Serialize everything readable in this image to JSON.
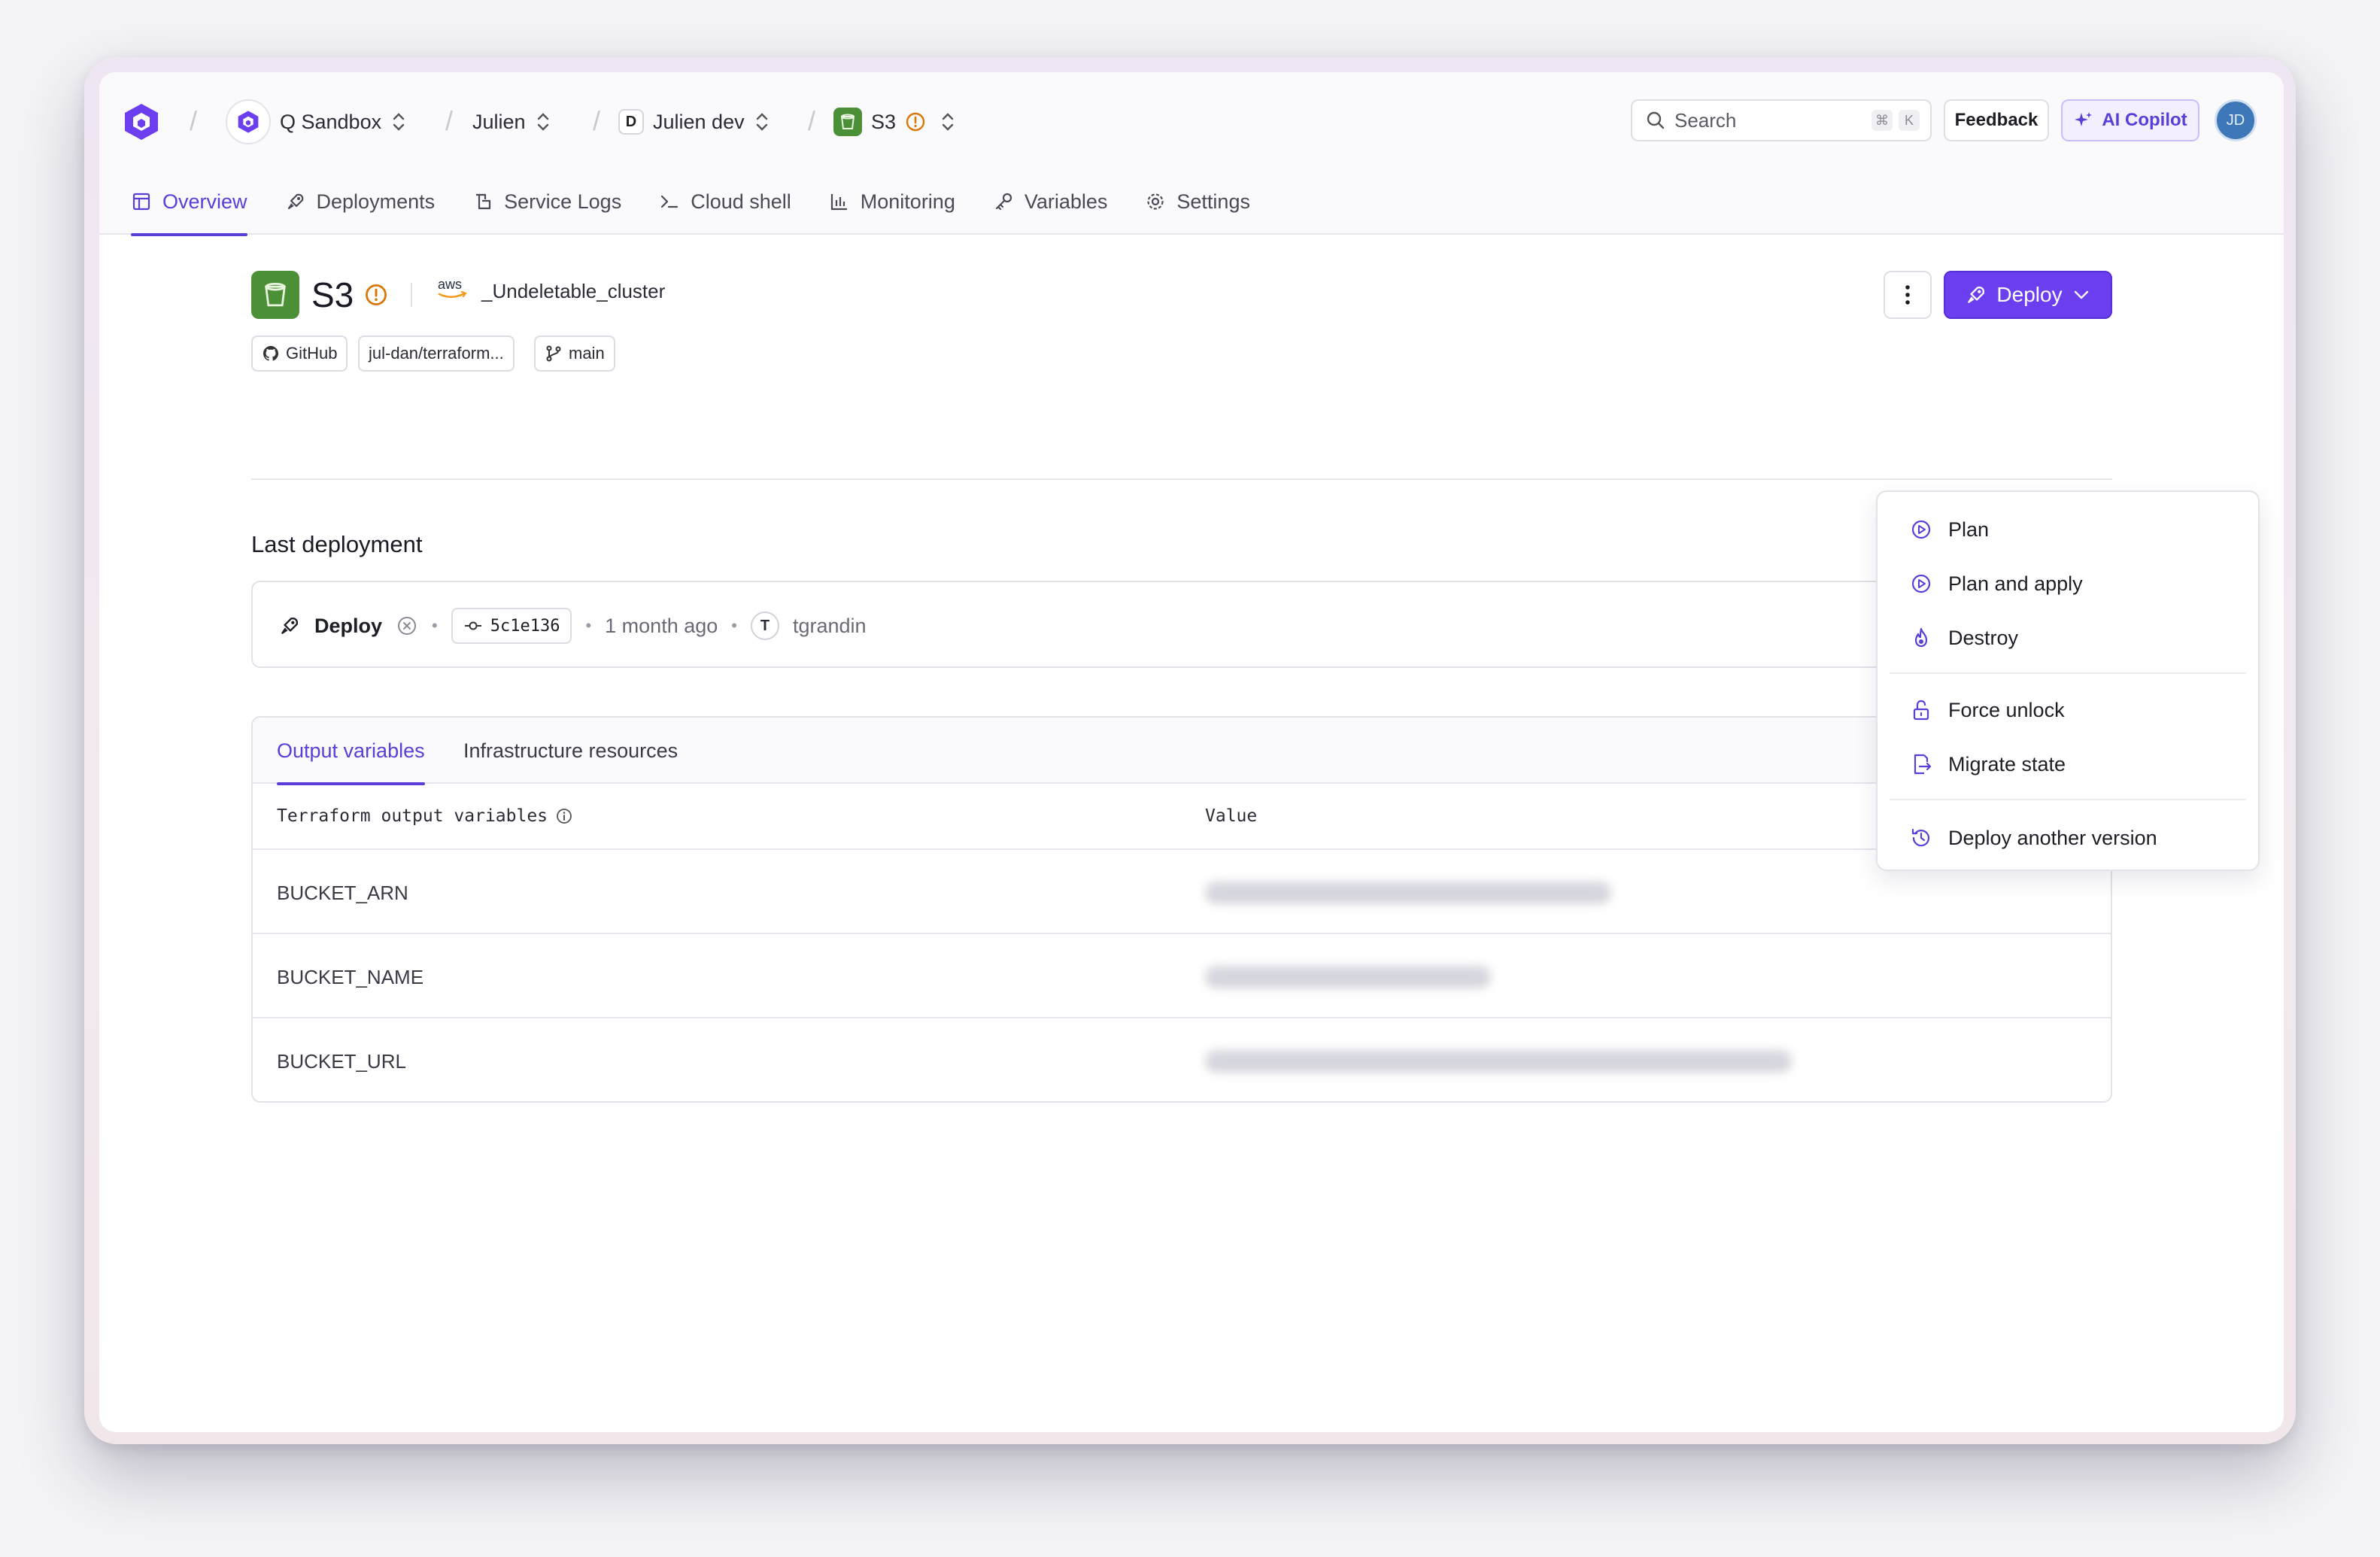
{
  "header": {
    "breadcrumbs": [
      {
        "label": "Q Sandbox"
      },
      {
        "label": "Julien"
      },
      {
        "label": "Julien dev",
        "badge": "D"
      },
      {
        "label": "S3"
      }
    ],
    "search": {
      "placeholder": "Search",
      "shortcut": [
        "⌘",
        "K"
      ]
    },
    "feedback_label": "Feedback",
    "copilot_label": "AI Copilot",
    "user_initials": "JD"
  },
  "tabs": [
    {
      "label": "Overview",
      "active": true,
      "icon": "layout-icon"
    },
    {
      "label": "Deployments",
      "active": false,
      "icon": "rocket-icon"
    },
    {
      "label": "Service Logs",
      "active": false,
      "icon": "logs-icon"
    },
    {
      "label": "Cloud shell",
      "active": false,
      "icon": "terminal-icon"
    },
    {
      "label": "Monitoring",
      "active": false,
      "icon": "chart-icon"
    },
    {
      "label": "Variables",
      "active": false,
      "icon": "key-icon"
    },
    {
      "label": "Settings",
      "active": false,
      "icon": "gear-icon"
    }
  ],
  "service": {
    "name": "S3",
    "provider": "aws",
    "cluster": "_Undeletable_cluster",
    "source": {
      "provider": "GitHub",
      "repo": "jul-dan/terraform...",
      "branch": "main"
    }
  },
  "actions": {
    "deploy_label": "Deploy"
  },
  "last_deployment": {
    "heading": "Last deployment",
    "action": "Deploy",
    "commit": "5c1e136",
    "time": "1 month ago",
    "author_initial": "T",
    "author": "tgrandin"
  },
  "outputs": {
    "tabs": [
      {
        "label": "Output variables",
        "active": true
      },
      {
        "label": "Infrastructure resources",
        "active": false
      }
    ],
    "columns": [
      "Terraform output variables",
      "Value"
    ],
    "rows": [
      {
        "key": "BUCKET_ARN"
      },
      {
        "key": "BUCKET_NAME"
      },
      {
        "key": "BUCKET_URL"
      }
    ]
  },
  "menu": {
    "items": [
      {
        "label": "Plan",
        "icon": "play-circle-icon"
      },
      {
        "label": "Plan and apply",
        "icon": "play-circle-icon"
      },
      {
        "label": "Destroy",
        "icon": "flame-icon"
      },
      {
        "label": "Force unlock",
        "icon": "unlock-icon"
      },
      {
        "label": "Migrate state",
        "icon": "file-export-icon"
      },
      {
        "label": "Deploy another version",
        "icon": "history-icon"
      }
    ]
  },
  "colors": {
    "accent": "#6b3ff0",
    "s3_green": "#4b8f36",
    "warning": "#d97706"
  }
}
